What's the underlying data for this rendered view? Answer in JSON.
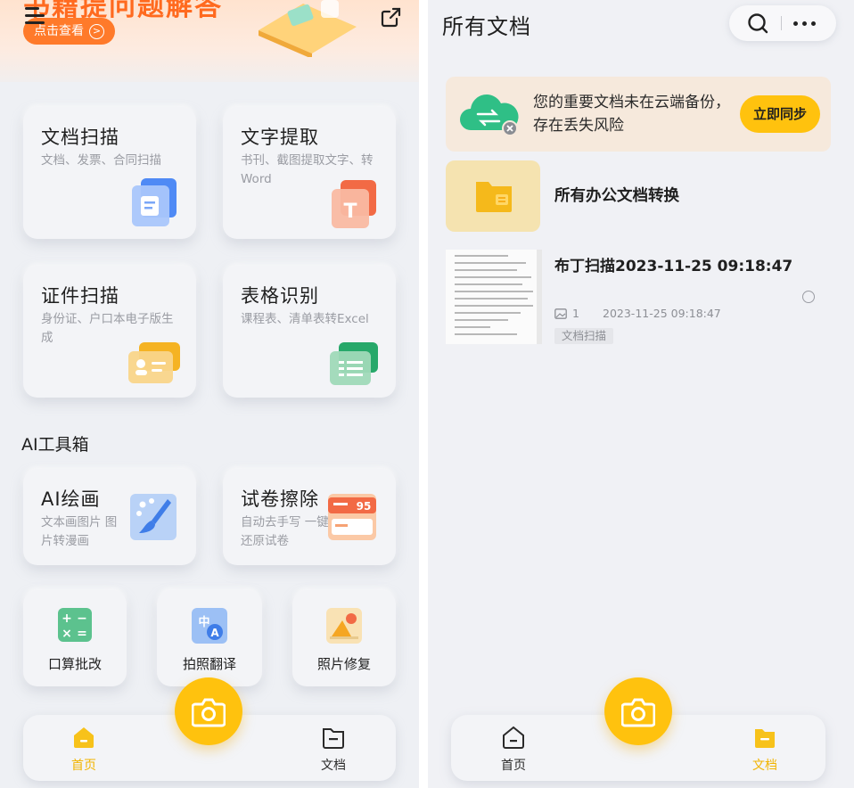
{
  "left": {
    "banner": {
      "title": "书籍提问题解答",
      "button_label": "点击查看"
    },
    "cards": [
      {
        "title": "文档扫描",
        "subtitle": "文档、发票、合同扫描",
        "icon": "document-scan-icon"
      },
      {
        "title": "文字提取",
        "subtitle": "书刊、截图提取文字、转Word",
        "icon": "text-extract-icon"
      },
      {
        "title": "证件扫描",
        "subtitle": "身份证、户口本电子版生成",
        "icon": "id-card-icon"
      },
      {
        "title": "表格识别",
        "subtitle": "课程表、清单表转Excel",
        "icon": "table-recognize-icon"
      }
    ],
    "ai_toolbox": {
      "title": "AI工具箱",
      "cards": [
        {
          "title": "AI绘画",
          "subtitle": "文本画图片 图片转漫画",
          "icon": "paintbrush-icon"
        },
        {
          "title": "试卷擦除",
          "subtitle": "自动去手写 一键还原试卷",
          "icon": "exam-erase-icon",
          "badge": "95"
        }
      ]
    },
    "tools": [
      {
        "label": "口算批改",
        "icon": "calculator-icon"
      },
      {
        "label": "拍照翻译",
        "icon": "translate-icon"
      },
      {
        "label": "照片修复",
        "icon": "photo-repair-icon"
      }
    ],
    "nav": {
      "home_label": "首页",
      "docs_label": "文档",
      "active": "home"
    }
  },
  "right": {
    "title": "所有文档",
    "sync_banner": {
      "message": "您的重要文档未在云端备份，存在丢失风险",
      "button_label": "立即同步"
    },
    "folder": {
      "label": "所有办公文档转换"
    },
    "documents": [
      {
        "title": "布丁扫描2023-11-25 09:18:47",
        "page_count": "1",
        "date": "2023-11-25 09:18:47",
        "tag": "文档扫描"
      }
    ],
    "nav": {
      "home_label": "首页",
      "docs_label": "文档",
      "active": "docs"
    }
  },
  "colors": {
    "accent_yellow": "#ffc20e",
    "banner_orange": "#ff6a1f",
    "active_nav": "#f2b400",
    "background": "#eef0f4"
  }
}
